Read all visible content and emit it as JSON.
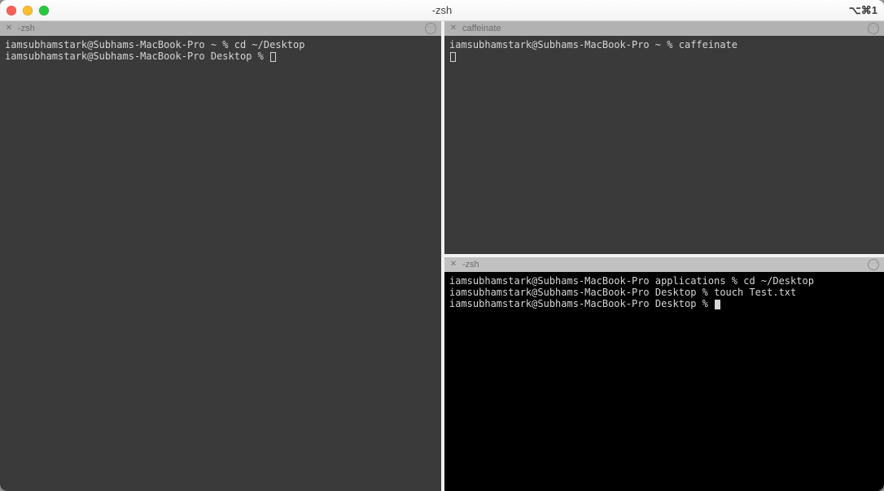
{
  "window": {
    "title": "-zsh",
    "shortcut_hint": "⌥⌘1"
  },
  "colors": {
    "term_gray_bg": "#3a3a3a",
    "term_black_bg": "#000000",
    "tabbar_bg": "#b3b2b2"
  },
  "panes": {
    "left": {
      "tab_title": "-zsh",
      "lines": [
        "iamsubhamstark@Subhams-MacBook-Pro ~ % cd ~/Desktop",
        "iamsubhamstark@Subhams-MacBook-Pro Desktop % "
      ],
      "cursor_filled": false
    },
    "right_top": {
      "tab_title": "caffeinate",
      "lines": [
        "iamsubhamstark@Subhams-MacBook-Pro ~ % caffeinate",
        ""
      ],
      "cursor_filled": false
    },
    "right_bottom": {
      "tab_title": "-zsh",
      "lines": [
        "iamsubhamstark@Subhams-MacBook-Pro applications % cd ~/Desktop",
        "iamsubhamstark@Subhams-MacBook-Pro Desktop % touch Test.txt",
        "iamsubhamstark@Subhams-MacBook-Pro Desktop % "
      ],
      "cursor_filled": true
    }
  }
}
